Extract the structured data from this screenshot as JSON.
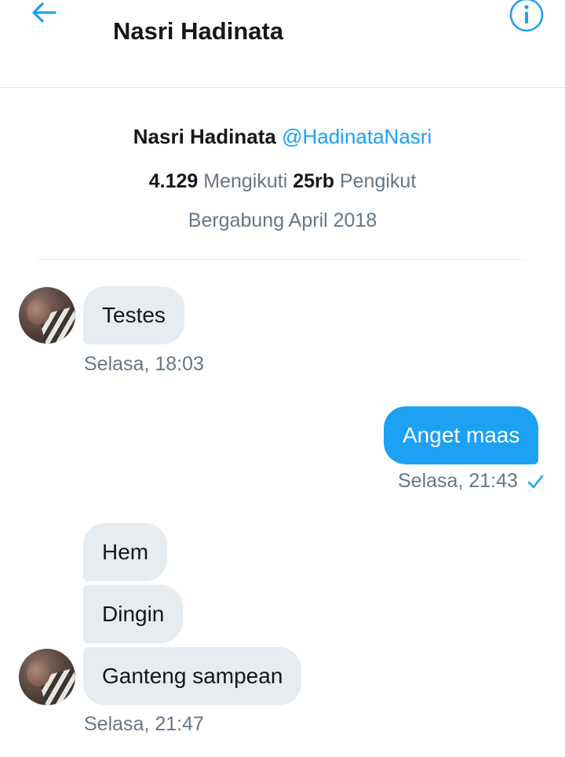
{
  "header": {
    "title": "Nasri Hadinata",
    "back_icon": "arrow-left-icon",
    "info_icon": "info-icon",
    "accent_color": "#1da1f2"
  },
  "profile": {
    "name": "Nasri Hadinata",
    "handle": "@HadinataNasri",
    "following_count": "4.129",
    "following_label": "Mengikuti",
    "followers_count": "25rb",
    "followers_label": "Pengikut",
    "joined": "Bergabung April 2018"
  },
  "messages": [
    {
      "direction": "in",
      "text": "Testes"
    },
    {
      "direction": "out",
      "text": "Anget maas"
    },
    {
      "direction": "in",
      "text": "Hem"
    },
    {
      "direction": "in",
      "text": "Dingin"
    },
    {
      "direction": "in",
      "text": "Ganteng sampean"
    }
  ],
  "timestamps": {
    "t1": "Selasa, 18:03",
    "t2": "Selasa, 21:43",
    "t3": "Selasa, 21:47"
  },
  "colors": {
    "incoming_bubble": "#e6ecf0",
    "outgoing_bubble": "#1da1f2",
    "secondary_text": "#657786"
  }
}
